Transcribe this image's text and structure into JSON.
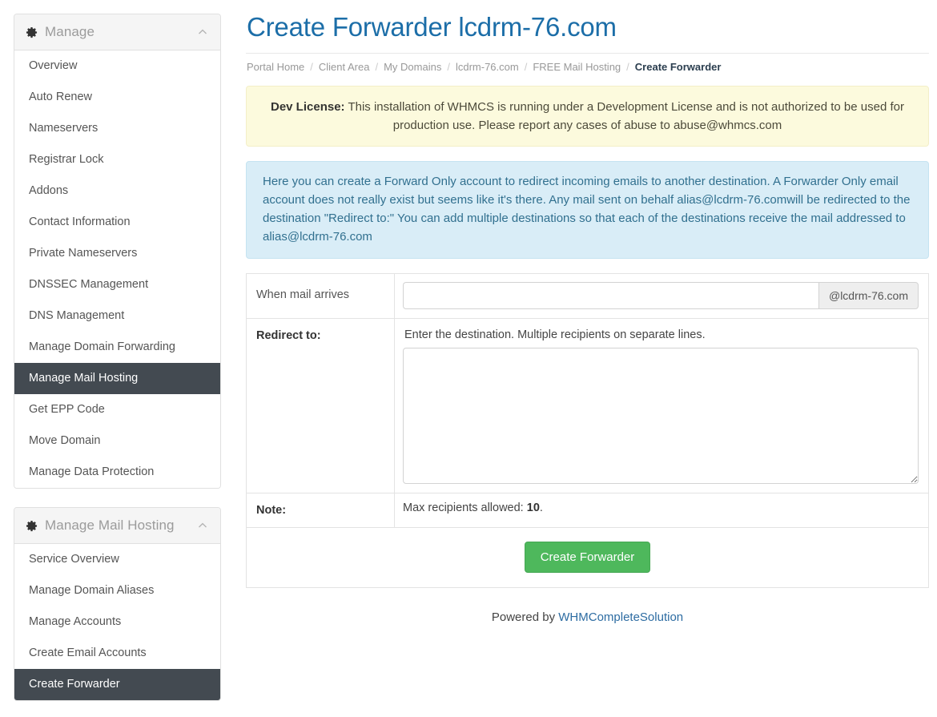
{
  "sidebar": {
    "panels": [
      {
        "title": "Manage",
        "gear_icon": "gear-icon",
        "collapse_icon": "chevron-up-icon",
        "items": [
          {
            "label": "Overview",
            "active": false
          },
          {
            "label": "Auto Renew",
            "active": false
          },
          {
            "label": "Nameservers",
            "active": false
          },
          {
            "label": "Registrar Lock",
            "active": false
          },
          {
            "label": "Addons",
            "active": false
          },
          {
            "label": "Contact Information",
            "active": false
          },
          {
            "label": "Private Nameservers",
            "active": false
          },
          {
            "label": "DNSSEC Management",
            "active": false
          },
          {
            "label": "DNS Management",
            "active": false
          },
          {
            "label": "Manage Domain Forwarding",
            "active": false
          },
          {
            "label": "Manage Mail Hosting",
            "active": true
          },
          {
            "label": "Get EPP Code",
            "active": false
          },
          {
            "label": "Move Domain",
            "active": false
          },
          {
            "label": "Manage Data Protection",
            "active": false
          }
        ]
      },
      {
        "title": "Manage Mail Hosting",
        "gear_icon": "gear-icon",
        "collapse_icon": "chevron-up-icon",
        "items": [
          {
            "label": "Service Overview",
            "active": false
          },
          {
            "label": "Manage Domain Aliases",
            "active": false
          },
          {
            "label": "Manage Accounts",
            "active": false
          },
          {
            "label": "Create Email Accounts",
            "active": false
          },
          {
            "label": "Create Forwarder",
            "active": true
          }
        ]
      }
    ]
  },
  "main": {
    "page_title": "Create Forwarder lcdrm-76.com",
    "breadcrumb": {
      "separator": "/",
      "items": [
        {
          "label": "Portal Home",
          "current": false
        },
        {
          "label": "Client Area",
          "current": false
        },
        {
          "label": "My Domains",
          "current": false
        },
        {
          "label": "lcdrm-76.com",
          "current": false
        },
        {
          "label": "FREE Mail Hosting",
          "current": false
        },
        {
          "label": "Create Forwarder",
          "current": true
        }
      ]
    },
    "alerts": {
      "dev_license": {
        "strong": "Dev License:",
        "text": " This installation of WHMCS is running under a Development License and is not authorized to be used for production use. Please report any cases of abuse to abuse@whmcs.com",
        "background": "#fcfadd",
        "border": "#f3efc8"
      },
      "info": {
        "text": "Here you can create a Forward Only account to redirect incoming emails to another destination. A Forwarder Only email account does not really exist but seems like it's there. Any mail sent on behalf alias@lcdrm-76.comwill be redirected to the destination \"Redirect to:\" You can add multiple destinations so that each of the destinations receive the mail addressed to alias@lcdrm-76.com",
        "background": "#d9edf7",
        "border": "#c5e3f1",
        "color": "#31708f"
      }
    },
    "form": {
      "when_mail_arrives": {
        "label": "When mail arrives",
        "input_value": "",
        "input_placeholder": "",
        "addon": "@lcdrm-76.com"
      },
      "redirect_to": {
        "label": "Redirect to:",
        "helper": "Enter the destination. Multiple recipients on separate lines.",
        "textarea_value": "",
        "textarea_placeholder": ""
      },
      "note": {
        "label": "Note:",
        "text_prefix": "Max recipients allowed: ",
        "max_recipients": "10",
        "text_suffix": "."
      },
      "submit_label": "Create Forwarder",
      "submit_color": "#4eb85c"
    },
    "footer": {
      "prefix": "Powered by ",
      "link": "WHMCompleteSolution",
      "link_color": "#2d6ca2"
    }
  }
}
